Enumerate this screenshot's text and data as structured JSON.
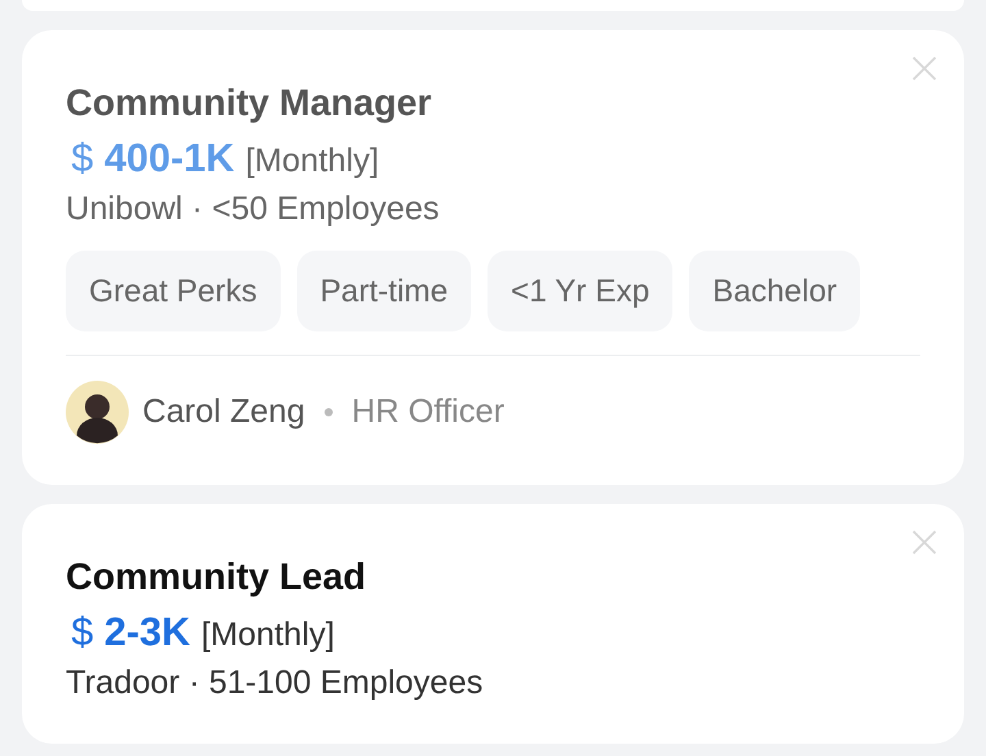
{
  "jobs": [
    {
      "title": "Community Manager",
      "viewed": true,
      "currency": "$",
      "salary": "400-1K",
      "period": "[Monthly]",
      "company": "Unibowl · <50 Employees",
      "tags": [
        "Great Perks",
        "Part-time",
        "<1 Yr Exp",
        "Bachelor"
      ],
      "recruiter": {
        "name": "Carol Zeng",
        "role": "HR Officer"
      }
    },
    {
      "title": "Community Lead",
      "viewed": false,
      "currency": "$",
      "salary": "2-3K",
      "period": "[Monthly]",
      "company": "Tradoor · 51-100 Employees"
    }
  ]
}
